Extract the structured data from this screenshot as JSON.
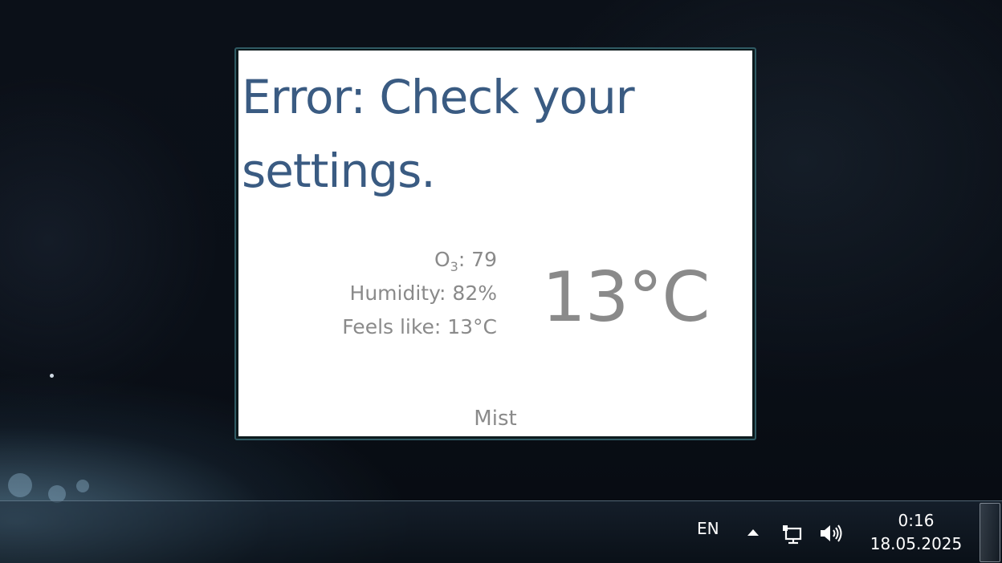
{
  "gadget": {
    "error_message": "Error: Check your settings.",
    "ozone_prefix": "O",
    "ozone_sub": "3",
    "ozone_value": ": 79",
    "humidity": "Humidity: 82%",
    "feels_like": "Feels like: 13°C",
    "temperature": "13°C",
    "condition": "Mist"
  },
  "taskbar": {
    "language": "EN",
    "tray_icons": [
      "show-hidden-icons-arrow-icon",
      "network-icon",
      "volume-icon"
    ],
    "clock": {
      "time": "0:16",
      "date": "18.05.2025"
    }
  },
  "colors": {
    "error_text": "#3a5b82",
    "secondary_text": "#8a8a8a",
    "gadget_border": "#2f5a63",
    "taskbar_text": "#ffffff"
  }
}
